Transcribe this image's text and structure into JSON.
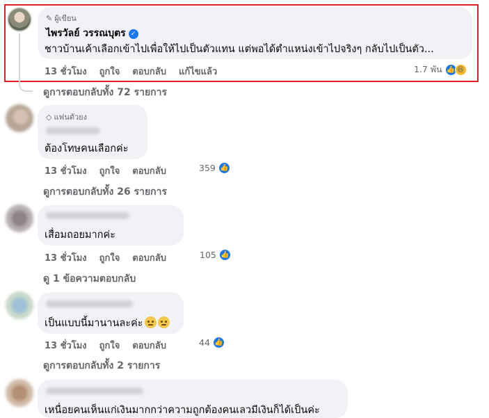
{
  "author_comment": {
    "badge": "ผู้เขียน",
    "name": "ไพรวัลย์ วรรณบุตร",
    "text": "ชาวบ้านเค้าเลือกเข้าไปเพื่อให้ไปเป็นตัวแทน แต่พอได้ตำแหน่งเข้าไปจริงๆ กลับไปเป็นตัว...",
    "time": "13 ชั่วโมง",
    "like": "ถูกใจ",
    "reply": "ตอบกลับ",
    "edited": "แก้ไขแล้ว",
    "reactions": "1.7 พัน",
    "view_replies": "ดูการตอบกลับทั้ง 72 รายการ"
  },
  "comments": [
    {
      "badge": "แฟนตัวยง",
      "text": "ต้องโทษคนเลือกค่ะ",
      "time": "13 ชั่วโมง",
      "like": "ถูกใจ",
      "reply": "ตอบกลับ",
      "reactions": "359",
      "view_replies": "ดูการตอบกลับทั้ง 26 รายการ"
    },
    {
      "text": "เสื่อมถอยมากค่ะ",
      "time": "13 ชั่วโมง",
      "like": "ถูกใจ",
      "reply": "ตอบกลับ",
      "reactions": "105",
      "view_replies": "ดู 1 ข้อความตอบกลับ"
    },
    {
      "text": "เป็นแบบนี้มานานละค่ะ",
      "time": "13 ชั่วโมง",
      "like": "ถูกใจ",
      "reply": "ตอบกลับ",
      "reactions": "44",
      "view_replies": "ดูการตอบกลับทั้ง 2 รายการ"
    },
    {
      "text": "เหนื่อยคนเห็นแก่เงินมากกว่าความถูกต้องคนเลวมีเงินก็ได้เป็นค่ะ"
    }
  ],
  "colors": {
    "highlight": "#e41e26",
    "like_blue": "#1877f2",
    "bubble": "#f0f2f5",
    "muted": "#65676b"
  },
  "icons": [
    "pencil-icon",
    "verified-icon",
    "like-reaction-icon",
    "haha-reaction-icon",
    "diamond-icon",
    "neutral-face-emoji"
  ]
}
